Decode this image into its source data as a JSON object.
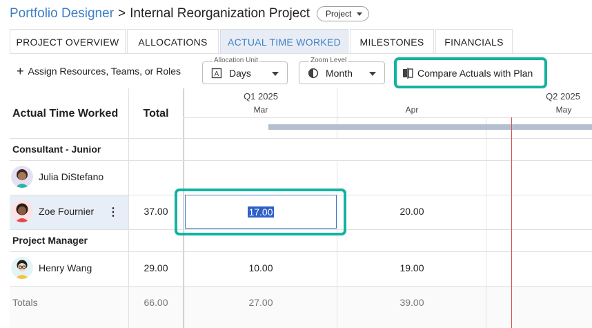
{
  "breadcrumb": {
    "parent": "Portfolio Designer",
    "separator": ">",
    "title": "Internal Reorganization Project",
    "type_label": "Project"
  },
  "tabs": [
    {
      "label": "PROJECT OVERVIEW",
      "active": false
    },
    {
      "label": "ALLOCATIONS",
      "active": false
    },
    {
      "label": "ACTUAL TIME WORKED",
      "active": true
    },
    {
      "label": "MILESTONES",
      "active": false
    },
    {
      "label": "FINANCIALS",
      "active": false
    }
  ],
  "toolbar": {
    "assign_label": "Assign Resources, Teams, or Roles",
    "allocation_unit": {
      "label": "Allocation Unit",
      "value": "Days"
    },
    "zoom_level": {
      "label": "Zoom Level",
      "value": "Month"
    },
    "compare_label": "Compare Actuals with Plan"
  },
  "grid": {
    "header": {
      "name_col": "Actual Time Worked",
      "total_col": "Total",
      "periods": [
        "Q1 2025",
        "Q2 2025"
      ],
      "months": [
        "Mar",
        "Apr",
        "May"
      ]
    },
    "groups": [
      {
        "name": "Consultant - Junior",
        "people": [
          {
            "name": "Julia DiStefano",
            "total": "",
            "values": [
              "",
              ""
            ]
          },
          {
            "name": "Zoe Fournier",
            "total": "37.00",
            "values": [
              "17.00",
              "20.00"
            ]
          }
        ]
      },
      {
        "name": "Project Manager",
        "people": [
          {
            "name": "Henry Wang",
            "total": "29.00",
            "values": [
              "10.00",
              "19.00"
            ]
          }
        ]
      }
    ],
    "totals": {
      "label": "Totals",
      "total": "66.00",
      "values": [
        "27.00",
        "39.00"
      ]
    }
  },
  "colors": {
    "accent": "#3b7fc4",
    "highlight": "#13b3a0",
    "active_tab_bg": "#e8edf5",
    "selected_row_bg": "#e8eef8",
    "today_line": "#d45050"
  }
}
